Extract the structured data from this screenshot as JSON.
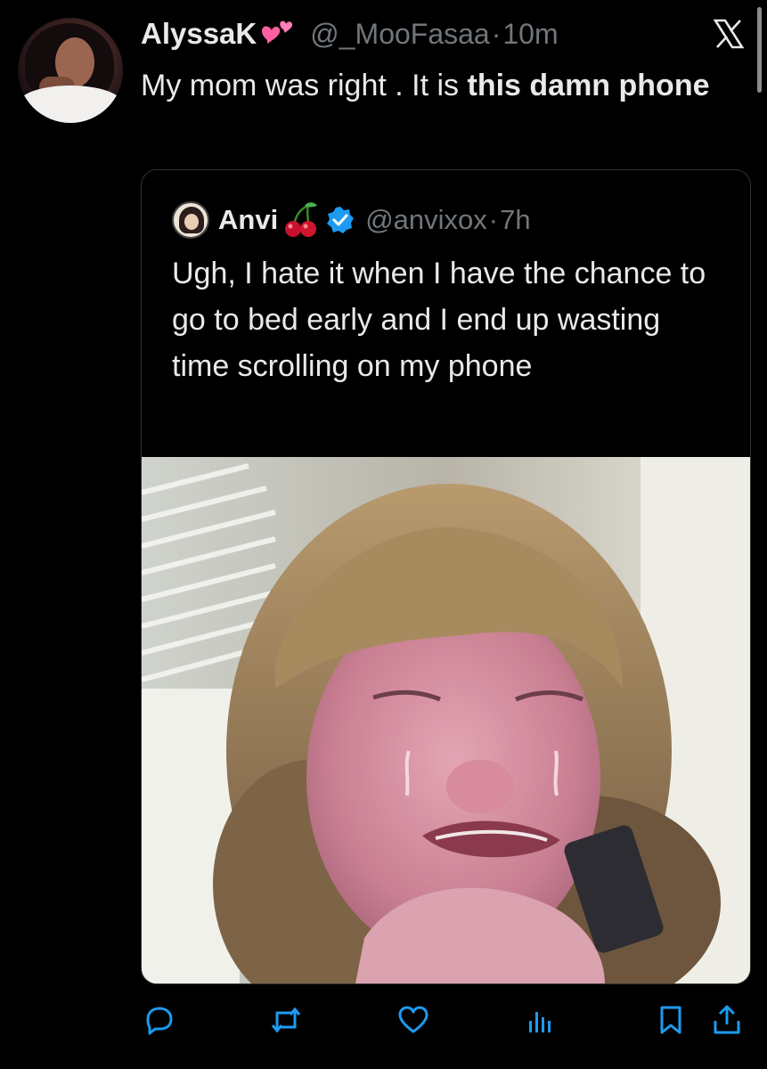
{
  "tweet": {
    "author_name": "AlyssaK",
    "author_handle": "@_MooFasaa",
    "separator": "·",
    "time": "10m",
    "text_plain": "My mom was right . It is ",
    "text_bold": "this damn phone"
  },
  "quote": {
    "author_name": "Anvi",
    "author_handle": "@anvixox",
    "separator": "·",
    "time": "7h",
    "text": "Ugh, I hate it when I have the chance to go to bed early and I end up wasting time scrolling on my phone"
  },
  "icons": {
    "close": "x-logo-icon",
    "heart_emoji": "pink-hearts-icon",
    "cherry_emoji": "cherry-icon",
    "verified": "verified-badge-icon",
    "reply": "reply-icon",
    "repost": "repost-icon",
    "like": "like-icon",
    "views": "views-icon",
    "bookmark": "bookmark-icon",
    "share": "share-icon"
  },
  "colors": {
    "background": "#000000",
    "text": "#e7e9ea",
    "secondary": "#71767b",
    "action_icons": "#1d9bf0",
    "verified": "#1d9bf0",
    "heart_emoji": "#ff5fa2"
  }
}
